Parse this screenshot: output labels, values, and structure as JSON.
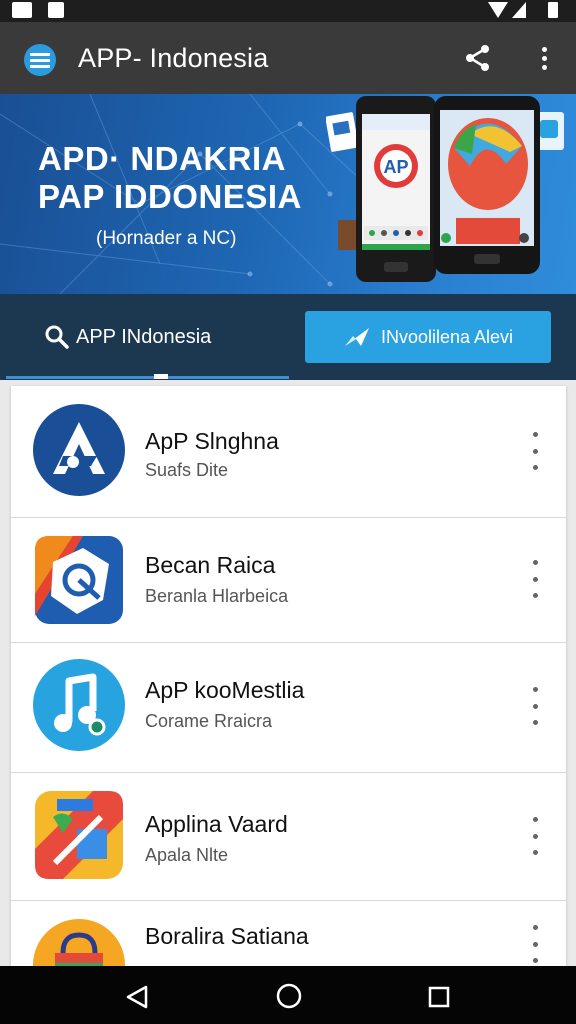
{
  "toolbar": {
    "title": "APP- Indonesia",
    "menu_icon": "menu-icon",
    "share_icon": "share-icon",
    "more_icon": "more-vert-icon"
  },
  "banner": {
    "line1": "APD· NDAKRIA",
    "line2": "PAP IDDONESIA",
    "subtitle": "(Hornader a NC)"
  },
  "tabs": {
    "search_label": "APP INdonesia",
    "search_icon": "search-icon",
    "cta_label": "INvoolilena Alevi",
    "cta_icon": "send-icon"
  },
  "apps": [
    {
      "title": "ApP Slnghna",
      "subtitle": "Suafs Dite",
      "icon": "a-logo-icon"
    },
    {
      "title": "Becan Raica",
      "subtitle": "Beranla Hlarbeica",
      "icon": "shield-puzzle-icon"
    },
    {
      "title": "ApP kooMestlia",
      "subtitle": "Corame Rraicra",
      "icon": "music-note-icon"
    },
    {
      "title": "Applina Vaard",
      "subtitle": "Apala Nlte",
      "icon": "maps-icon"
    },
    {
      "title": "Boralira Satiana",
      "subtitle": "",
      "icon": "shopping-bag-icon"
    }
  ],
  "colors": {
    "toolbar": "#3a3a3a",
    "accent": "#2aa2e2",
    "tab_row": "#1c3850",
    "banner": "#1e67b4"
  },
  "navbar": {
    "back_icon": "back-icon",
    "home_icon": "home-icon",
    "recent_icon": "recent-apps-icon"
  }
}
